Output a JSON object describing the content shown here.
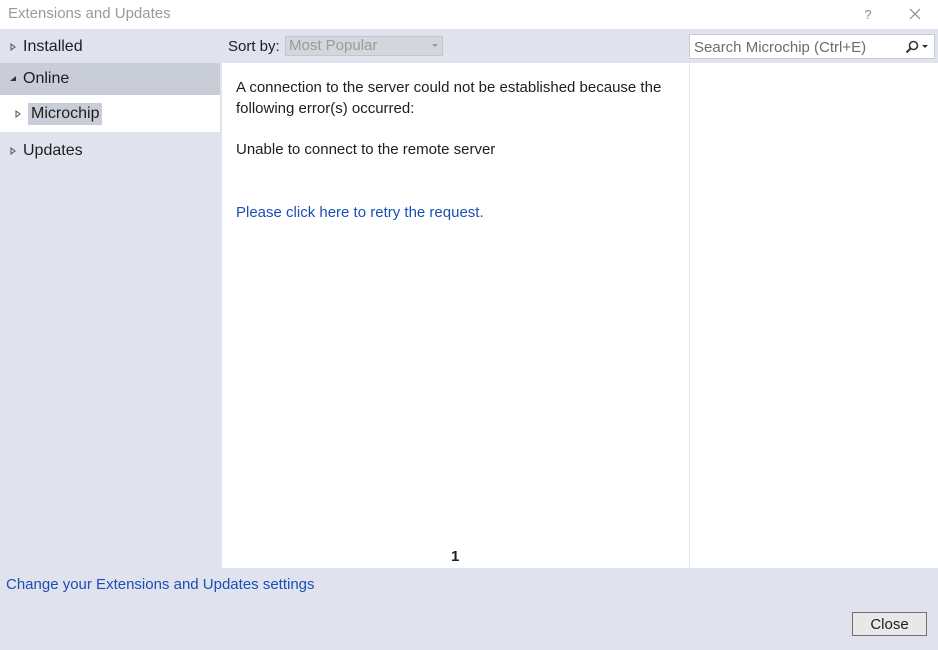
{
  "window": {
    "title": "Extensions and Updates",
    "help_label": "?"
  },
  "nav": {
    "items": [
      {
        "label": "Installed",
        "expanded": false
      },
      {
        "label": "Online",
        "expanded": true,
        "selected": true
      },
      {
        "label": "Microchip",
        "expanded": false,
        "highlighted": true
      },
      {
        "label": "Updates",
        "expanded": false
      }
    ]
  },
  "toolbar": {
    "sort_label": "Sort by:",
    "sort_value": "Most Popular",
    "search_placeholder": "Search Microchip (Ctrl+E)"
  },
  "main": {
    "error_message": "A connection to the server could not be established because the following error(s) occurred:",
    "error_detail": "Unable to connect to the remote server",
    "retry_link": "Please click here to retry the request.",
    "page_number": "1"
  },
  "footer": {
    "settings_link": "Change your Extensions and Updates settings",
    "close_label": "Close"
  },
  "colors": {
    "panel": "#e0e3ee",
    "selection": "#c9cdd8",
    "link": "#1a4fb3",
    "title_text": "#9a9a9a"
  },
  "icons": {
    "help": "question-mark-icon",
    "close": "close-icon",
    "collapsed": "triangle-right-icon",
    "expanded": "triangle-down-icon",
    "search": "search-icon",
    "dropdown": "chevron-down-icon"
  }
}
